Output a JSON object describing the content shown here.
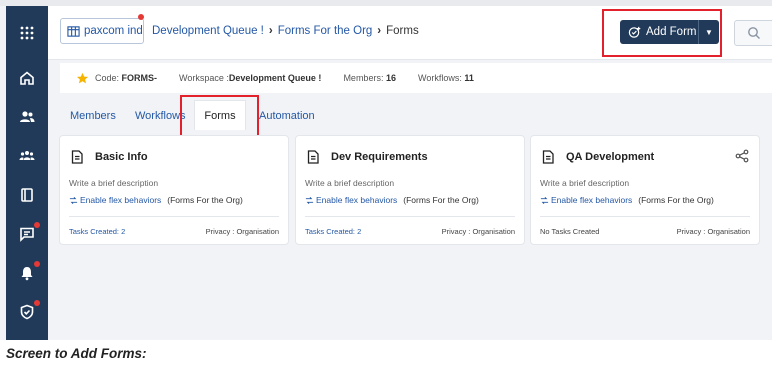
{
  "header": {
    "org_label": "paxcom ind",
    "breadcrumb": [
      "Development Queue !",
      "Forms For the Org",
      "Forms"
    ],
    "add_form_label": "Add Form"
  },
  "info": {
    "code_label": "Code:",
    "code_value": "FORMS-",
    "workspace_label": "Workspace :",
    "workspace_value": "Development Queue !",
    "members_label": "Members:",
    "members_value": "16",
    "workflows_label": "Workflows:",
    "workflows_value": "11"
  },
  "tabs": [
    "Members",
    "Workflows",
    "Forms",
    "Automation"
  ],
  "active_tab": "Forms",
  "cards": [
    {
      "title": "Basic Info",
      "description": "Write a brief description",
      "flex_link": "Enable flex behaviors",
      "flex_context": "(Forms For the Org)",
      "tasks": "Tasks Created: 2",
      "privacy": "Privacy : Organisation"
    },
    {
      "title": "Dev Requirements",
      "description": "Write a brief description",
      "flex_link": "Enable flex behaviors",
      "flex_context": "(Forms For the Org)",
      "tasks": "Tasks Created: 2",
      "privacy": "Privacy : Organisation"
    },
    {
      "title": "QA Development",
      "description": "Write a brief description",
      "flex_link": "Enable flex behaviors",
      "flex_context": "(Forms For the Org)",
      "tasks": "No Tasks Created",
      "privacy": "Privacy : Organisation"
    }
  ],
  "caption": "Screen to Add Forms:",
  "colors": {
    "sidebar": "#213a5a",
    "link": "#2458a6",
    "highlight": "#e3212d",
    "notification_dot": "#e53935",
    "star": "#f4b400"
  },
  "icons": {
    "sidebar": [
      "apps-grid-icon",
      "home-icon",
      "users-icon",
      "team-icon",
      "book-icon",
      "chat-icon",
      "bell-icon",
      "shield-icon"
    ],
    "header": [
      "org-building-icon",
      "add-form-icon",
      "dropdown-caret-icon",
      "search-icon"
    ],
    "cards": [
      "form-doc-icon",
      "flex-behavior-icon",
      "share-icon"
    ],
    "info": "star-icon"
  }
}
